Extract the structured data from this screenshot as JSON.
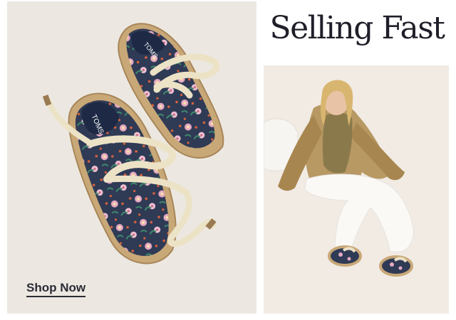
{
  "promo": {
    "title": "Selling Fast",
    "cta_label": "Shop Now",
    "product_image": {
      "brand_text": "TOMS"
    }
  },
  "colors": {
    "left_background": "#ece8e1",
    "right_background": "#f1ebe4",
    "shoe_print_base": "#2f3a55",
    "jute_sole": "#c9a878",
    "laces": "#ece2c6",
    "text": "#1f1f2a"
  }
}
